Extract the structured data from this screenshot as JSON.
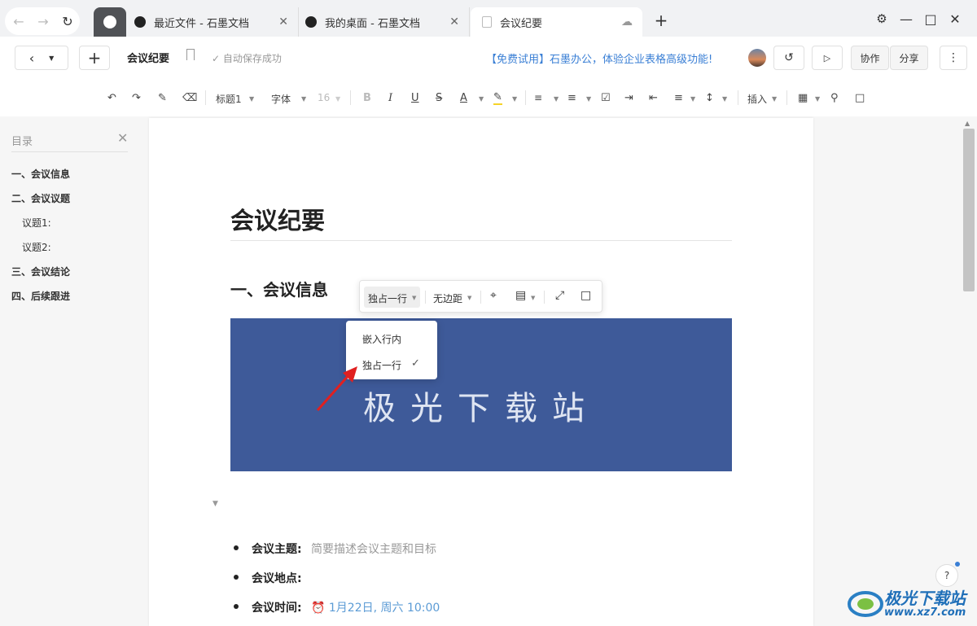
{
  "tabs": [
    {
      "label": "最近文件 - 石墨文档"
    },
    {
      "label": "我的桌面 - 石墨文档"
    },
    {
      "label": "会议纪要",
      "active": true
    }
  ],
  "header": {
    "doc_title": "会议纪要",
    "save_status": "自动保存成功",
    "promo": "【免费试用】石墨办公，体验企业表格高级功能!",
    "collab_label": "协作",
    "share_label": "分享"
  },
  "format_toolbar": {
    "heading": "标题1",
    "font": "字体",
    "font_size": "16",
    "insert": "插入"
  },
  "toc": {
    "title": "目录",
    "items": [
      {
        "label": "一、会议信息",
        "level": 1
      },
      {
        "label": "二、会议议题",
        "level": 1
      },
      {
        "label": "议题1:",
        "level": 2
      },
      {
        "label": "议题2:",
        "level": 2
      },
      {
        "label": "三、会议结论",
        "level": 1
      },
      {
        "label": "四、后续跟进",
        "level": 1
      }
    ]
  },
  "document": {
    "title": "会议纪要",
    "section1": "一、会议信息",
    "image_text": "极光下载站",
    "bullets": [
      {
        "label": "会议主题:",
        "value": "简要描述会议主题和目标"
      },
      {
        "label": "会议地点:",
        "value": ""
      },
      {
        "label": "会议时间:",
        "value": "1月22日, 周六 10:00"
      }
    ]
  },
  "image_toolbar": {
    "layout_label": "独占一行",
    "border_label": "无边距",
    "dropdown": [
      {
        "label": "嵌入行内"
      },
      {
        "label": "独占一行",
        "checked": true
      }
    ]
  },
  "watermark": {
    "brand": "极光下载站",
    "url": "www.xz7.com"
  },
  "colors": {
    "accent": "#3a7fd5",
    "banner": "#3e5a99",
    "arrow": "#e02020"
  }
}
